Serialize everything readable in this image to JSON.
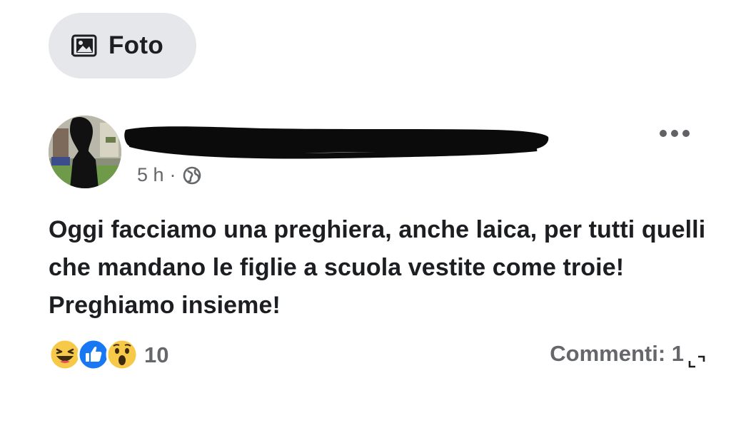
{
  "composer": {
    "photo_label": "Foto",
    "photo_icon": "photo-icon"
  },
  "post": {
    "author_name_redacted": true,
    "time": "5 h",
    "separator": "·",
    "audience_icon": "globe-icon",
    "menu_icon": "more-horizontal-icon",
    "text": "Oggi facciamo una preghiera, anche laica, per tutti quelli che mandano le figlie a scuola vestite come troie! Preghiamo insieme!",
    "reactions": {
      "icons": [
        "haha-icon",
        "like-icon",
        "wow-icon"
      ],
      "count": "10"
    },
    "comments_label": "Commenti: 1"
  },
  "overlay": {
    "expand_icon": "expand-icon"
  },
  "colors": {
    "chip_bg": "#e6e7ea",
    "text": "#1c1e21",
    "secondary": "#65676b",
    "like_blue": "#1877f2",
    "reaction_yellow": "#f7c948"
  }
}
